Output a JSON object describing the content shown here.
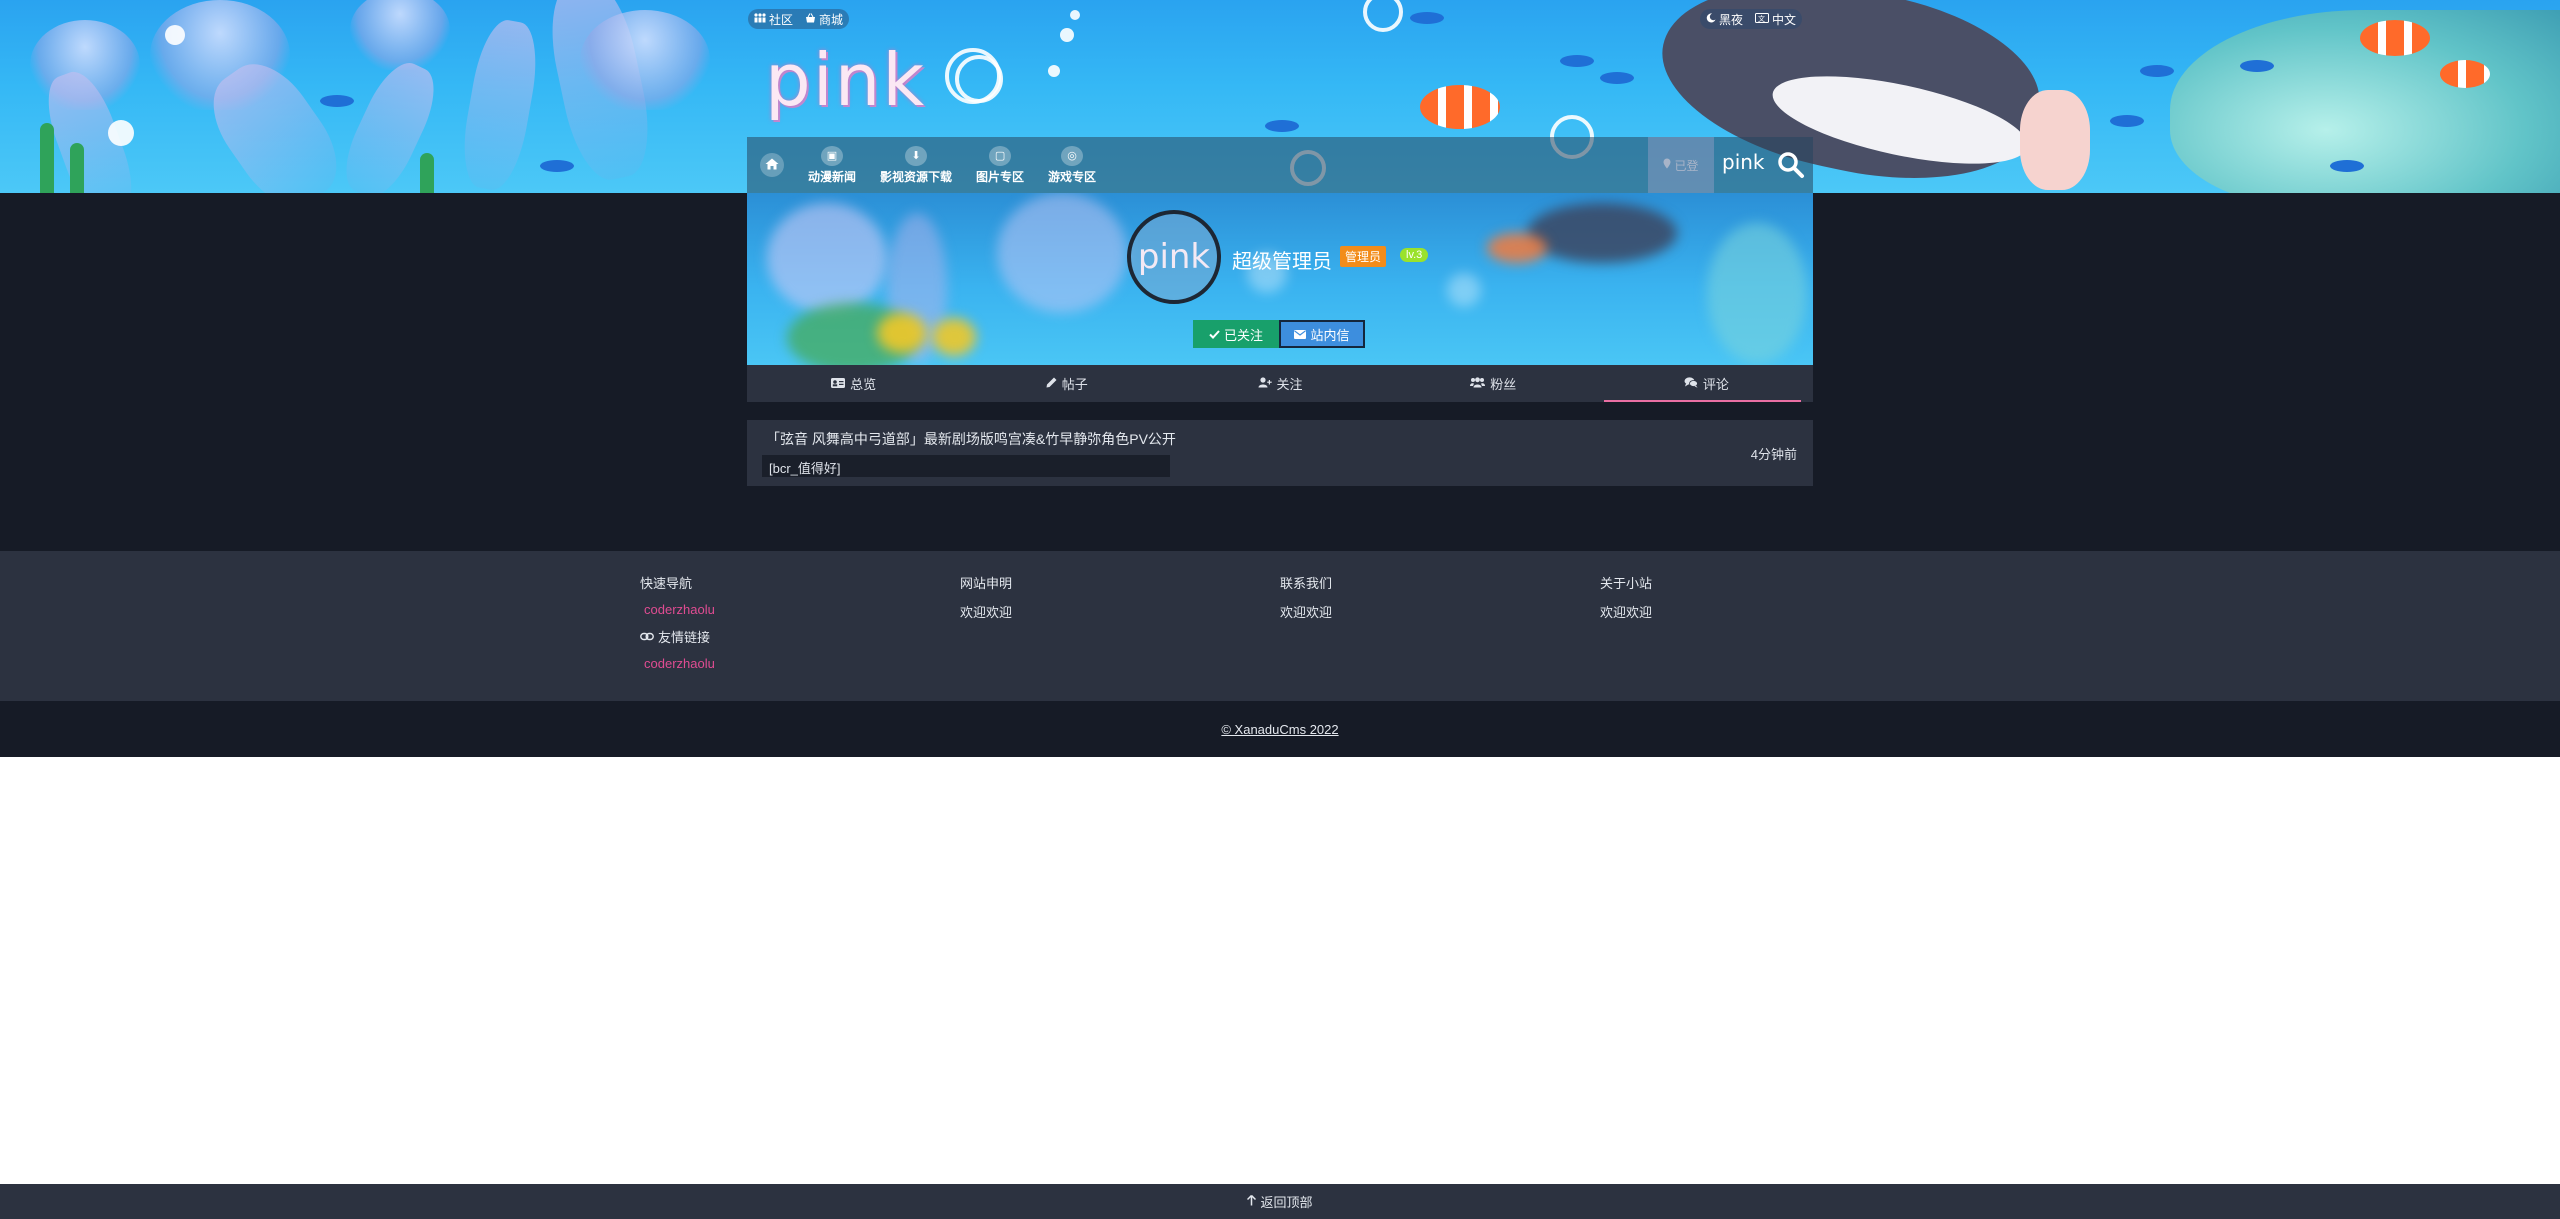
{
  "topbar": {
    "community": "社区",
    "shop": "商城",
    "night_mode": "黑夜",
    "language": "中文"
  },
  "site": {
    "logo_text": "pink"
  },
  "nav": {
    "items": [
      {
        "label": "动漫新闻",
        "icon": "tv-icon"
      },
      {
        "label": "影视资源下载",
        "icon": "download-icon"
      },
      {
        "label": "图片专区",
        "icon": "image-icon"
      },
      {
        "label": "游戏专区",
        "icon": "gamepad-icon"
      }
    ],
    "login_status": "已登",
    "mini_logo": "pink"
  },
  "profile": {
    "avatar_text": "pink",
    "username": "超级管理员",
    "role": "管理员",
    "level": "lv.3",
    "followed_label": "已关注",
    "message_label": "站内信"
  },
  "tabs": [
    {
      "label": "总览",
      "icon": "id-card-icon"
    },
    {
      "label": "帖子",
      "icon": "pen-icon"
    },
    {
      "label": "关注",
      "icon": "user-plus-icon"
    },
    {
      "label": "粉丝",
      "icon": "users-icon"
    },
    {
      "label": "评论",
      "icon": "comments-icon",
      "active": true
    }
  ],
  "comment": {
    "title": "「弦音 风舞高中弓道部」最新剧场版鸣宫凑&竹早静弥角色PV公开",
    "body": "[bcr_值得好]",
    "time": "4分钟前"
  },
  "footer": {
    "quick_nav": "快速导航",
    "quick_nav_link": "coderzhaolu",
    "friend_links": "友情链接",
    "friend_link": "coderzhaolu",
    "statement": "网站申明",
    "statement_text": "欢迎欢迎",
    "contact": "联系我们",
    "contact_text": "欢迎欢迎",
    "about": "关于小站",
    "about_text": "欢迎欢迎",
    "copyright": "© XanaduCms 2022"
  },
  "back_to_top": "返回顶部",
  "colors": {
    "dark_bg": "#161b26",
    "card_bg": "#2c3240",
    "accent_pink": "#e96fa3",
    "follow_green": "#18a06b",
    "message_blue": "#3d8ede",
    "role_orange": "#f28c1a",
    "level_green": "#9ae22c"
  }
}
